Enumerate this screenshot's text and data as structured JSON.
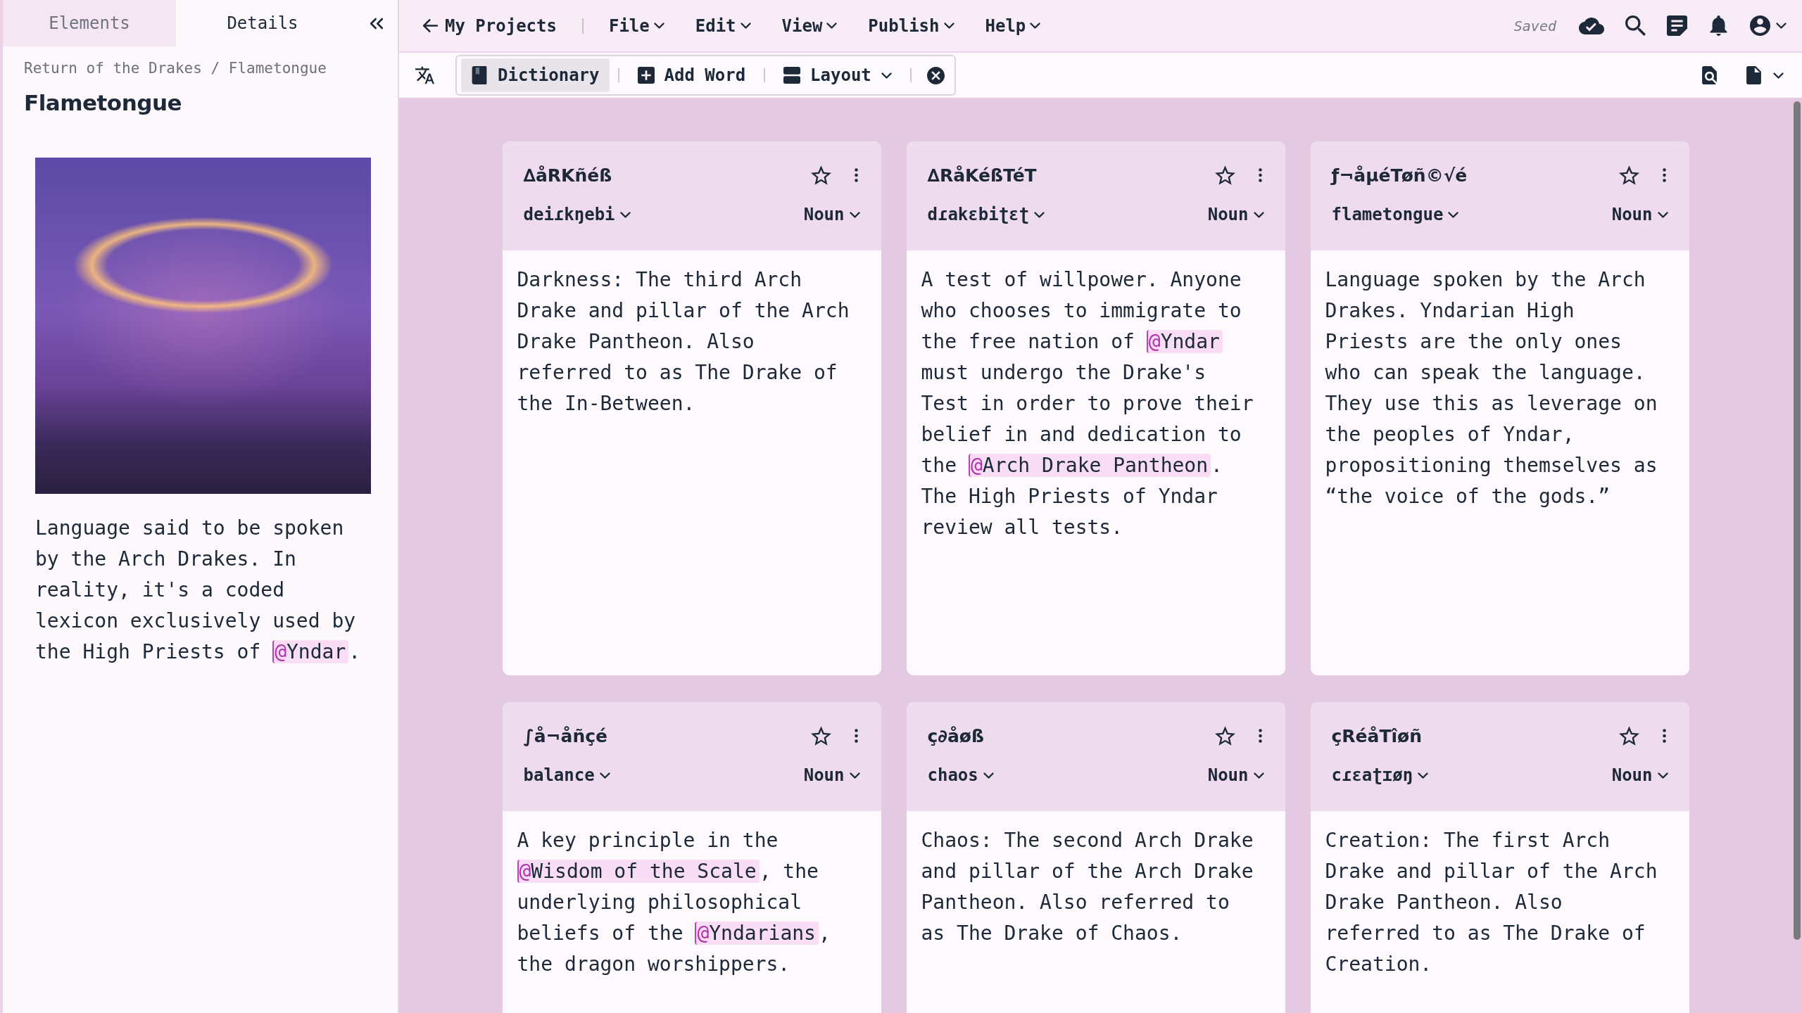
{
  "sidebar": {
    "tabs": [
      {
        "label": "Elements",
        "selected": false
      },
      {
        "label": "Details",
        "selected": true
      }
    ],
    "breadcrumb": "Return of the Drakes / Flametongue",
    "title": "Flametongue",
    "description": [
      {
        "kind": "text",
        "text": "Language said to be spoken by the Arch Drakes. In reality, it's a coded lexicon exclusively used by the High Priests of "
      },
      {
        "kind": "mention",
        "text": "@Yndar"
      },
      {
        "kind": "text",
        "text": "."
      }
    ]
  },
  "menu_bar": {
    "back_link": "My Projects",
    "menus": [
      "File",
      "Edit",
      "View",
      "Publish",
      "Help"
    ],
    "save_status": "Saved"
  },
  "toolbar": {
    "items": [
      {
        "kind": "view",
        "label": "Dictionary",
        "selected": true
      },
      {
        "kind": "action",
        "label": "Add Word",
        "selected": false
      },
      {
        "kind": "dropdown",
        "label": "Layout",
        "selected": false
      }
    ]
  },
  "entries": [
    {
      "word": "∆åRKñéß",
      "starred": false,
      "pronunciation": "deiɾkŋebi",
      "part_of_speech": "Noun",
      "definition": [
        {
          "kind": "text",
          "text": "Darkness: The third Arch Drake and pillar of the Arch Drake Pantheon. Also referred to as The Drake of the In-Between."
        }
      ]
    },
    {
      "word": "∆RåKéßTéT",
      "starred": false,
      "pronunciation": "dɾakɛbiʈɛʈ",
      "part_of_speech": "Noun",
      "definition": [
        {
          "kind": "text",
          "text": "A test of willpower. Anyone who chooses to immigrate to the free nation of "
        },
        {
          "kind": "mention",
          "text": "@Yndar"
        },
        {
          "kind": "text",
          "text": " must undergo the Drake's Test in order to prove their belief in and dedication to the "
        },
        {
          "kind": "mention",
          "text": "@Arch Drake Pantheon"
        },
        {
          "kind": "text",
          "text": ". The High Priests of Yndar review all tests."
        }
      ]
    },
    {
      "word": "ƒ¬åµéTøñ©√é",
      "starred": false,
      "pronunciation": "flametongue",
      "part_of_speech": "Noun",
      "definition": [
        {
          "kind": "text",
          "text": "Language spoken by the Arch Drakes. Yndarian High Priests are the only ones who can speak the language. They use this as leverage on the peoples of Yndar, propositioning themselves as “the voice of the gods.”"
        }
      ]
    },
    {
      "word": "∫å¬åñçé",
      "starred": false,
      "pronunciation": "balance",
      "part_of_speech": "Noun",
      "definition": [
        {
          "kind": "text",
          "text": "A key principle in the "
        },
        {
          "kind": "mention",
          "text": "@Wisdom of the Scale"
        },
        {
          "kind": "text",
          "text": ", the underlying philosophical beliefs of the "
        },
        {
          "kind": "mention",
          "text": "@Yndarians"
        },
        {
          "kind": "text",
          "text": ", the dragon worshippers."
        }
      ]
    },
    {
      "word": "ç∂åøß",
      "starred": false,
      "pronunciation": "chaos",
      "part_of_speech": "Noun",
      "definition": [
        {
          "kind": "text",
          "text": "Chaos: The second Arch Drake and pillar of the Arch Drake Pantheon. Also referred to as The Drake of Chaos."
        }
      ]
    },
    {
      "word": "çRéåTîøñ",
      "starred": false,
      "pronunciation": "cɾɛaʈɪøŋ",
      "part_of_speech": "Noun",
      "definition": [
        {
          "kind": "text",
          "text": "Creation: The first Arch Drake and pillar of the Arch Drake Pantheon. Also referred to as The Drake of Creation."
        }
      ]
    }
  ]
}
